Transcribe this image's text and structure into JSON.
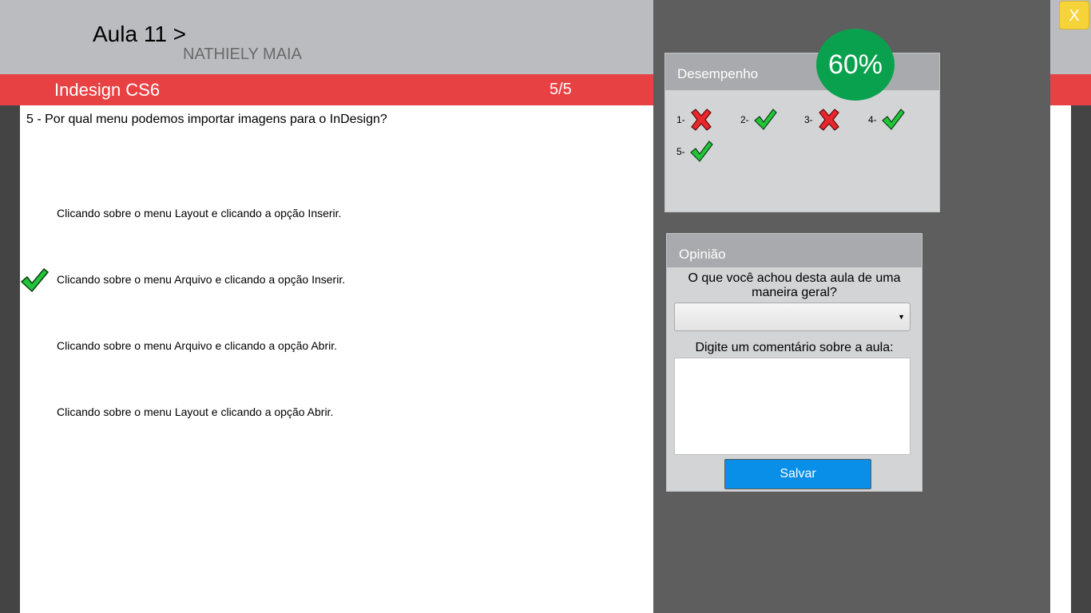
{
  "header": {
    "lesson_title": "Aula 11 >",
    "author": "NATHIELY MAIA"
  },
  "course_bar": {
    "course_name": "Indesign CS6",
    "progress": "5/5"
  },
  "question": {
    "text": "5 - Por qual menu podemos importar imagens para o InDesign?",
    "answers": [
      {
        "text": "Clicando sobre o menu Layout e clicando a opção Inserir.",
        "checked": false
      },
      {
        "text": "Clicando sobre o menu Arquivo e clicando a opção Inserir.",
        "checked": true
      },
      {
        "text": "Clicando sobre o menu Arquivo e clicando a opção Abrir.",
        "checked": false
      },
      {
        "text": "Clicando sobre o menu Layout e clicando a opção Abrir.",
        "checked": false
      }
    ]
  },
  "close_button": {
    "label": "X"
  },
  "performance": {
    "title": "Desempenho",
    "score": "60%",
    "results": [
      {
        "label": "1-",
        "result": "wrong"
      },
      {
        "label": "2-",
        "result": "correct"
      },
      {
        "label": "3-",
        "result": "wrong"
      },
      {
        "label": "4-",
        "result": "correct"
      },
      {
        "label": "5-",
        "result": "correct"
      }
    ]
  },
  "opinion": {
    "title": "Opinião",
    "question": "O que você achou desta aula de uma maneira geral?",
    "select_value": "",
    "comment_label": "Digite um comentário sobre a aula:",
    "comment_value": "",
    "save_label": "Salvar"
  },
  "colors": {
    "accent_red": "#e84144",
    "score_green": "#0aa14e",
    "save_blue": "#0a8fe8",
    "close_yellow": "#f7d33a"
  },
  "icons": {
    "correct": "check-icon",
    "wrong": "x-icon",
    "select_arrow": "caret-down-icon"
  }
}
